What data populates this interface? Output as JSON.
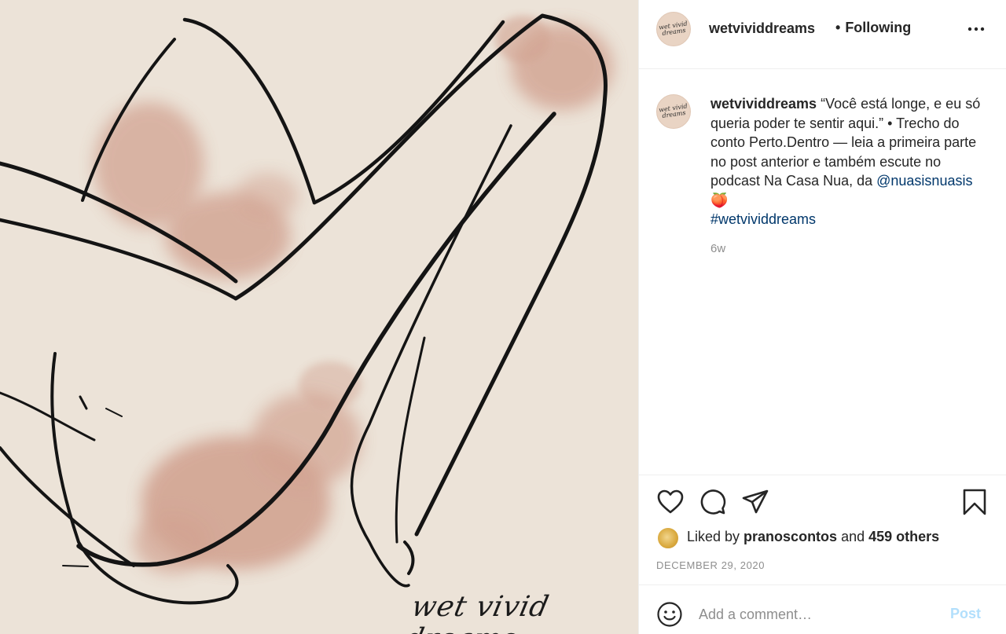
{
  "account": {
    "username": "wetvividdreams",
    "avatar_text": "wet vivid dreams",
    "follow_status": "Following",
    "separator": "•"
  },
  "caption": {
    "username": "wetvividdreams",
    "text": "“Você está longe, e eu só queria poder te sentir aqui.” • Trecho do conto Perto.Dentro — leia a primeira parte no post anterior e também escute no podcast Na Casa Nua, da ",
    "mention": "@nuasisnuasis",
    "emoji": "🍑",
    "hashtag": "#wetvividdreams",
    "age": "6w"
  },
  "image": {
    "signature": "wet vivid dreams",
    "background_color": "#ece3d8",
    "blush_color": "#c98e7a"
  },
  "actions": {
    "icons": [
      "heart-icon",
      "comment-icon",
      "share-icon",
      "bookmark-icon"
    ]
  },
  "likes": {
    "prefix": "Liked by ",
    "user": "pranoscontos",
    "middle": " and ",
    "others": "459 others"
  },
  "date": "DECEMBER 29, 2020",
  "comment": {
    "placeholder": "Add a comment…",
    "post_label": "Post"
  },
  "colors": {
    "link": "#00376b",
    "muted": "#8e8e8e",
    "post_disabled": "#b2dffc"
  }
}
